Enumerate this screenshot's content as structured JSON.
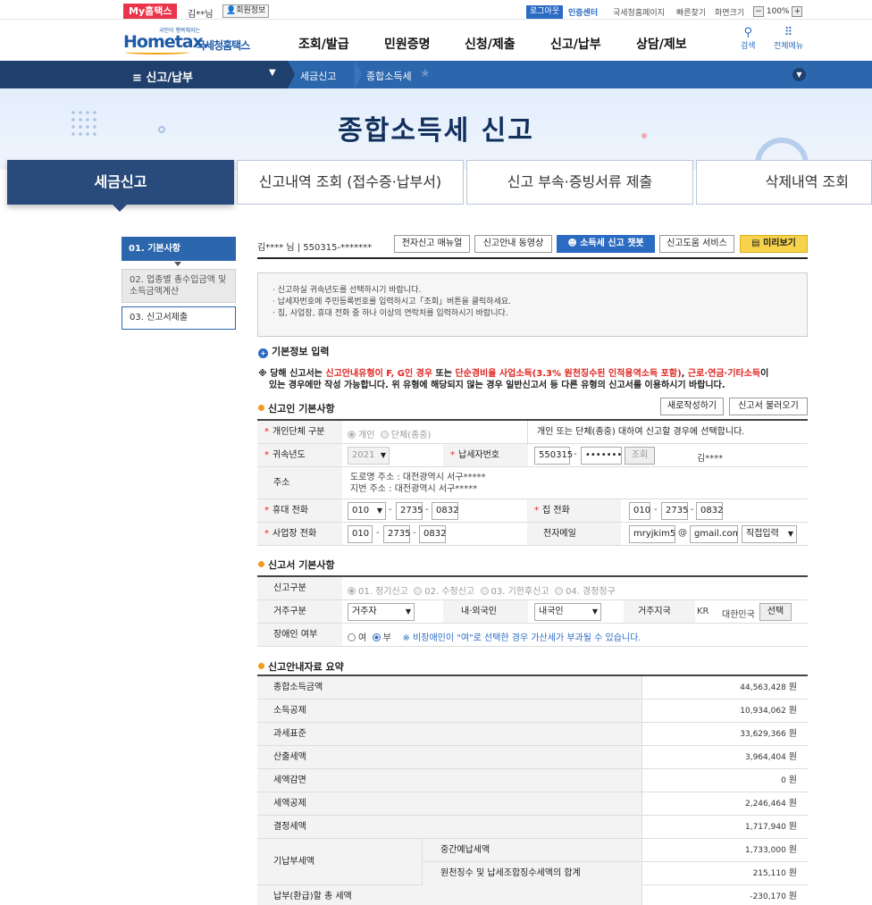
{
  "topbar": {
    "mytax": "My홈택스",
    "user": "김**님",
    "member_info": "회원정보",
    "logout": "로그아웃",
    "cert_center": "인증센터",
    "links": [
      "국세청홈페이지",
      "빠른찾기",
      "화면크기"
    ],
    "zoom_minus": "−",
    "zoom_value": "100%",
    "zoom_plus": "+"
  },
  "header": {
    "logo_tiny": "국민이 행복해지는",
    "logo_brand": "Hometax.",
    "logo_sub": "국세청홈택스",
    "nav": [
      "조회/발급",
      "민원증명",
      "신청/제출",
      "신고/납부",
      "상담/제보"
    ],
    "search": "검색",
    "all_menu": "전체메뉴"
  },
  "breadcrumb": {
    "menu": "≡  신고/납부",
    "items": [
      "세금신고",
      "종합소득세"
    ]
  },
  "hero_title": "종합소득세 신고",
  "tabs": [
    "세금신고",
    "신고내역 조회 (접수증·납부서)",
    "신고 부속·증빙서류 제출",
    "삭제내역 조회"
  ],
  "steps": [
    "01. 기본사항",
    "02. 업종별 총수입금액 및 소득금액계산",
    "03. 신고서제출"
  ],
  "user_row": {
    "name": "김**** 님  |  550315-*******",
    "buttons": [
      "전자신고 매뉴얼",
      "신고안내 동영상",
      "소득세 신고 챗봇",
      "신고도움 서비스",
      "미리보기"
    ]
  },
  "notice": [
    "· 신고하실 귀속년도를 선택하시기 바랍니다.",
    "· 납세자번호에 주민등록번호를 입력하시고「조회」버튼을 클릭하세요.",
    "· 집, 사업장, 휴대 전화 중 하나 이상의 연락처를 입력하시기 바랍니다."
  ],
  "basic_info": {
    "title": "기본정보 입력",
    "warn_prefix": "※ 당해 신고서는 ",
    "warn_red1": "신고안내유형이 F, G인 경우",
    "warn_mid1": " 또는 ",
    "warn_red2": "단순경비율 사업소득(3.3% 원천징수된 인적용역소득 포함)",
    "warn_mid2": ", ",
    "warn_red3": "근로·연금·기타소득",
    "warn_suffix1": "이",
    "warn_line2": "있는 경우에만 작성 가능합니다. 위 유형에 해당되지 않는 경우 일반신고서 등 다른 유형의 신고서를 이용하시기 바랍니다."
  },
  "filer": {
    "title": "신고인 기본사항",
    "btn_new": "새로작성하기",
    "btn_load": "신고서 불러오기",
    "type_label": "개인단체 구분",
    "type_opt1": "개인",
    "type_opt2": "단체(종중)",
    "type_hint": "개인 또는 단체(종중) 대하여 신고할 경우에 선택합니다.",
    "year_label": "귀속년도",
    "year_value": "2021",
    "taxno_label": "납세자번호",
    "taxno_front": "550315",
    "taxno_back": "•••••••",
    "lookup": "조회",
    "taxno_name": "김****",
    "addr_label": "주소",
    "addr_road": "도로명 주소 :  대전광역시 서구*****",
    "addr_lot": "지번 주소 :  대전광역시 서구*****",
    "mobile_label": "휴대 전화",
    "mobile": [
      "010",
      "2735",
      "0832"
    ],
    "home_label": "집 전화",
    "home": [
      "010",
      "2735",
      "0832"
    ],
    "biz_label": "사업장 전화",
    "biz": [
      "010",
      "2735",
      "0832"
    ],
    "email_label": "전자메일",
    "email_id": "mryjkim55",
    "email_at": "@",
    "email_domain": "gmail.com",
    "email_select": "직접입력"
  },
  "report": {
    "title": "신고서 기본사항",
    "kind_label": "신고구분",
    "kinds": [
      "01. 정기신고",
      "02. 수정신고",
      "03. 기한후신고",
      "04. 경정청구"
    ],
    "residence_label": "거주구분",
    "residence": "거주자",
    "national_label": "내·외국인",
    "national": "내국인",
    "country_label": "거주지국",
    "country_code": "KR",
    "country_name": "대한민국",
    "country_btn": "선택",
    "disabled_label": "장애인 여부",
    "disabled_yes": "여",
    "disabled_no": "부",
    "disabled_hint": "※ 비장애인이 \"여\"로 선택한 경우 가산세가 부과될 수 있습니다."
  },
  "summary": {
    "title": "신고안내자료 요약",
    "won": "원",
    "rows": [
      {
        "label": "종합소득금액",
        "value": "44,563,428"
      },
      {
        "label": "소득공제",
        "value": "10,934,062"
      },
      {
        "label": "과세표준",
        "value": "33,629,366"
      },
      {
        "label": "산출세액",
        "value": "3,964,404"
      },
      {
        "label": "세액감면",
        "value": "0"
      },
      {
        "label": "세액공제",
        "value": "2,246,464"
      },
      {
        "label": "결정세액",
        "value": "1,717,940"
      }
    ],
    "prepaid_label": "기납부세액",
    "prepaid_rows": [
      {
        "label": "중간예납세액",
        "value": "1,733,000"
      },
      {
        "label": "원천징수 및 납세조합징수세액의 합계",
        "value": "215,110"
      }
    ],
    "total_label": "납부(환급)할 총 세액",
    "total_value": "-230,170"
  }
}
